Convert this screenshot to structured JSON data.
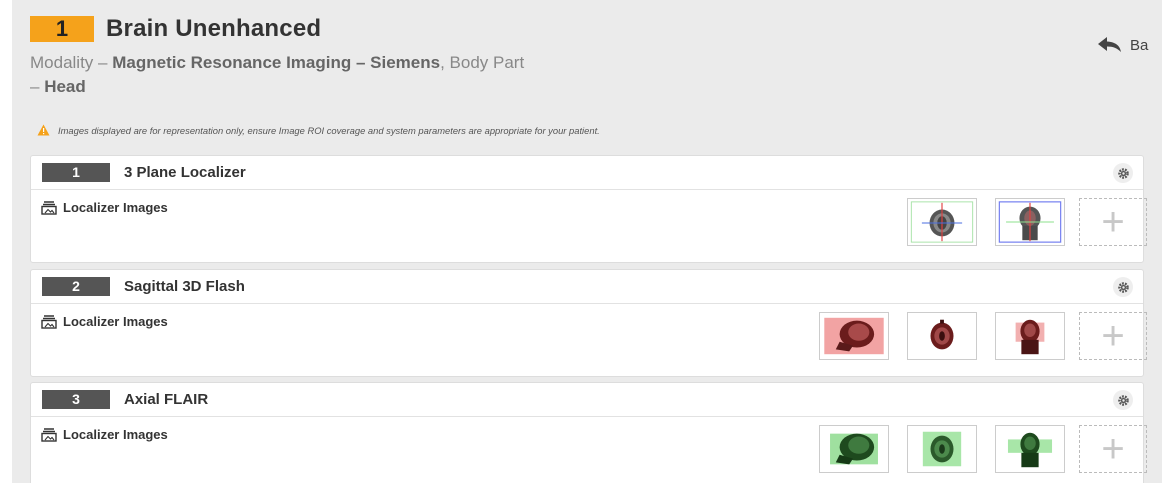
{
  "protocol": {
    "number": "1",
    "title": "Brain Unenhanced",
    "modality_label": "Modality",
    "dash": "–",
    "modality_value": "Magnetic Resonance Imaging – Siemens",
    "comma": ",",
    "body_part_label": "Body Part",
    "body_part_value": "Head"
  },
  "back_label": "Ba",
  "warning_text": "Images displayed are for representation only, ensure Image ROI coverage and system parameters are appropriate for your patient.",
  "series": [
    {
      "number": "1",
      "name": "3 Plane Localizer",
      "localizer_label": "Localizer Images",
      "thumbnail_count": 2,
      "add_label": "+"
    },
    {
      "number": "2",
      "name": "Sagittal 3D Flash",
      "localizer_label": "Localizer Images",
      "thumbnail_count": 3,
      "add_label": "+"
    },
    {
      "number": "3",
      "name": "Axial FLAIR",
      "localizer_label": "Localizer Images",
      "thumbnail_count": 3,
      "add_label": "+"
    }
  ],
  "colors": {
    "accent": "#f5a21b",
    "series_badge": "#555555",
    "background": "#ebebeb",
    "warning": "#f5a21b"
  },
  "icons": {
    "back": "reply-arrow-icon",
    "warning": "warning-triangle-icon",
    "localizer": "stack-images-icon",
    "settings": "gear-icon",
    "add": "plus-icon"
  }
}
